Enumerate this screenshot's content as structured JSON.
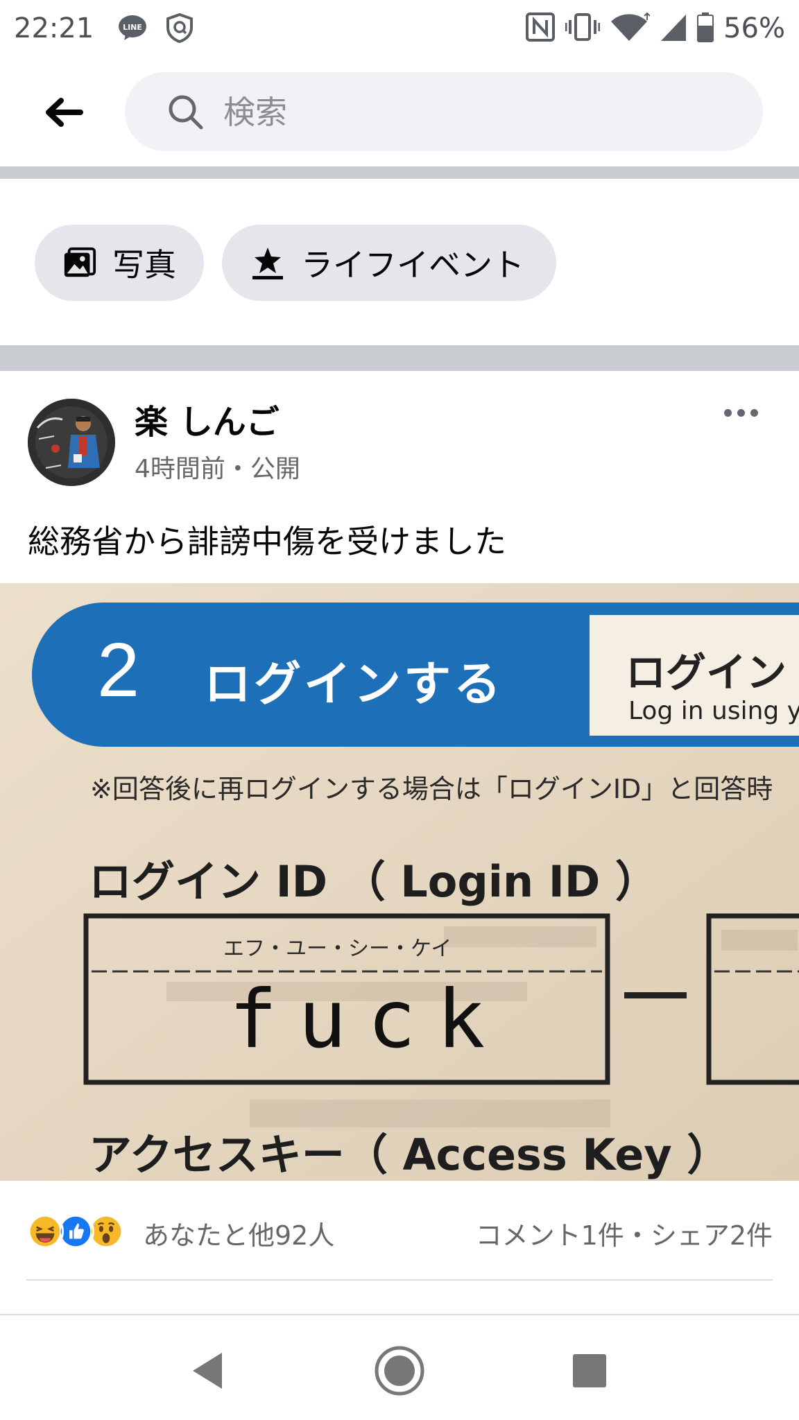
{
  "status_bar": {
    "time": "22:21",
    "left_icons": [
      "line-app-icon",
      "shield-app-icon"
    ],
    "right_icons": [
      "nfc-icon",
      "vibrate-icon",
      "wifi-icon",
      "cell-signal-icon",
      "battery-icon"
    ],
    "battery_percent": "56%"
  },
  "header": {
    "back_icon": "back-arrow-icon",
    "search_placeholder": "検索"
  },
  "chips": [
    {
      "label": "写真",
      "icon": "photos-icon"
    },
    {
      "label": "ライフイベント",
      "icon": "life-event-icon"
    }
  ],
  "post": {
    "author": "楽 しんご",
    "meta": "4時間前・公開",
    "text": "総務省から誹謗中傷を受けました",
    "photo": {
      "step_number": "2",
      "step_title": "ログインする",
      "side_panel_title": "ログイン",
      "side_panel_subtitle": "Log in using yo",
      "note": "※回答後に再ログインする場合は「ログインID」と回答時",
      "login_label": "ログイン ID （ Login ID ）",
      "field_furigana": "エフ・ユー・シー・ケイ",
      "field_value": "fuck",
      "access_key_label": "アクセスキー（ Access Key ）"
    },
    "reactions_text": "あなたと他92人",
    "comments_shares_text": "コメント1件・シェア2件",
    "reaction_types": [
      "haha",
      "like",
      "wow"
    ]
  },
  "colors": {
    "like_blue": "#1877f2",
    "reaction_yellow": "#f7b928",
    "form_blue": "#1d6fb8",
    "paper": "#e6d8c4"
  },
  "nav_bar": {
    "buttons": [
      "back-nav-icon",
      "home-nav-icon",
      "recents-nav-icon"
    ]
  }
}
